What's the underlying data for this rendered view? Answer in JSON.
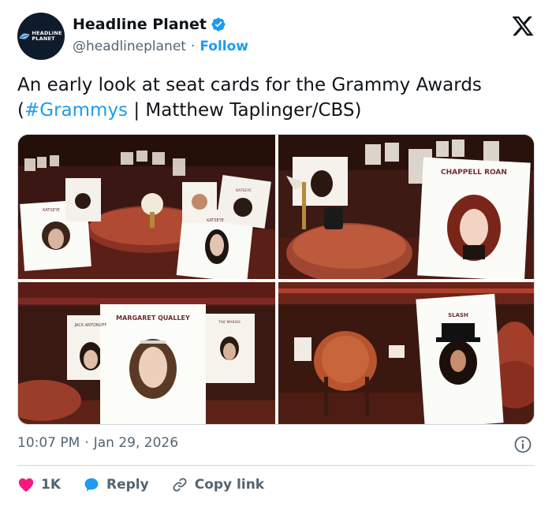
{
  "author": {
    "display_name": "Headline Planet",
    "handle": "@headlineplanet",
    "separator": "·",
    "follow_label": "Follow",
    "avatar_text_line1": "HEADLINE",
    "avatar_text_line2": "PLANET"
  },
  "tweet": {
    "text_prefix": "An early look at seat cards for the Grammy Awards (",
    "hashtag": "#Grammys",
    "text_suffix": " | Matthew Taplinger/CBS)"
  },
  "media": {
    "photo1_cards": [
      "KATSEYE",
      "KATSEYE",
      "KATSEYE"
    ],
    "photo2_card": "CHAPPELL ROAN",
    "photo3_cards": [
      "JACK ANTONOFF",
      "MARGARET QUALLEY",
      "THE MARIAS"
    ],
    "photo4_card": "SLASH"
  },
  "timestamp": {
    "time": "10:07 PM",
    "separator": "·",
    "date": "Jan 29, 2026"
  },
  "actions": {
    "likes": "1K",
    "reply_label": "Reply",
    "copy_label": "Copy link"
  },
  "colors": {
    "accent": "#1d9bf0",
    "like": "#f91880",
    "text": "#0f1419",
    "muted": "#536471"
  },
  "icons": [
    "verified-badge-icon",
    "x-logo-icon",
    "info-icon",
    "heart-icon",
    "reply-bubble-icon",
    "link-icon"
  ]
}
